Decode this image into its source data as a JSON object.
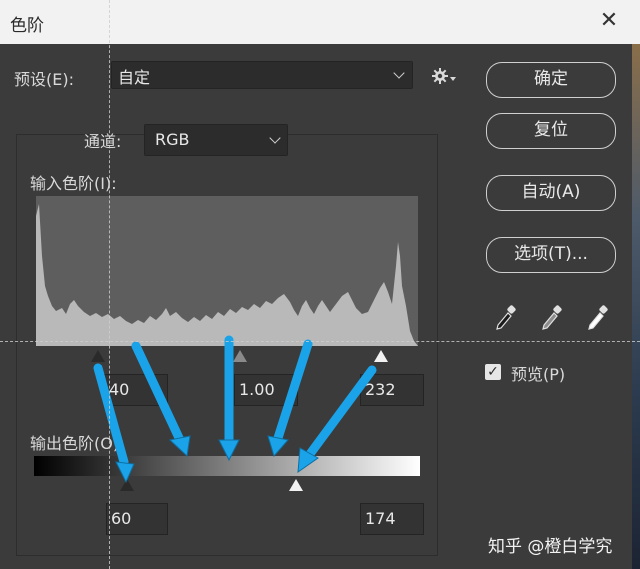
{
  "dialog": {
    "title": "色阶"
  },
  "preset": {
    "label": "预设(E):",
    "value": "自定"
  },
  "channel": {
    "label": "通道:",
    "value": "RGB"
  },
  "input_levels": {
    "label": "输入色阶(I):",
    "black": "40",
    "gamma": "1.00",
    "white": "232"
  },
  "output_levels": {
    "label": "输出色阶(O):",
    "black": "60",
    "white": "174"
  },
  "buttons": {
    "ok": "确定",
    "reset": "复位",
    "auto": "自动(A)",
    "options": "选项(T)..."
  },
  "preview": {
    "label": "预览(P)",
    "checked": true
  },
  "icons": [
    "gear-icon",
    "close-icon",
    "black-eyedropper-icon",
    "gray-eyedropper-icon",
    "white-eyedropper-icon",
    "checkmark-icon"
  ],
  "colors": {
    "annotation_arrow": "#1aa3e8",
    "histogram": "#b9b9b9"
  },
  "watermark": "知乎 @橙白学究"
}
